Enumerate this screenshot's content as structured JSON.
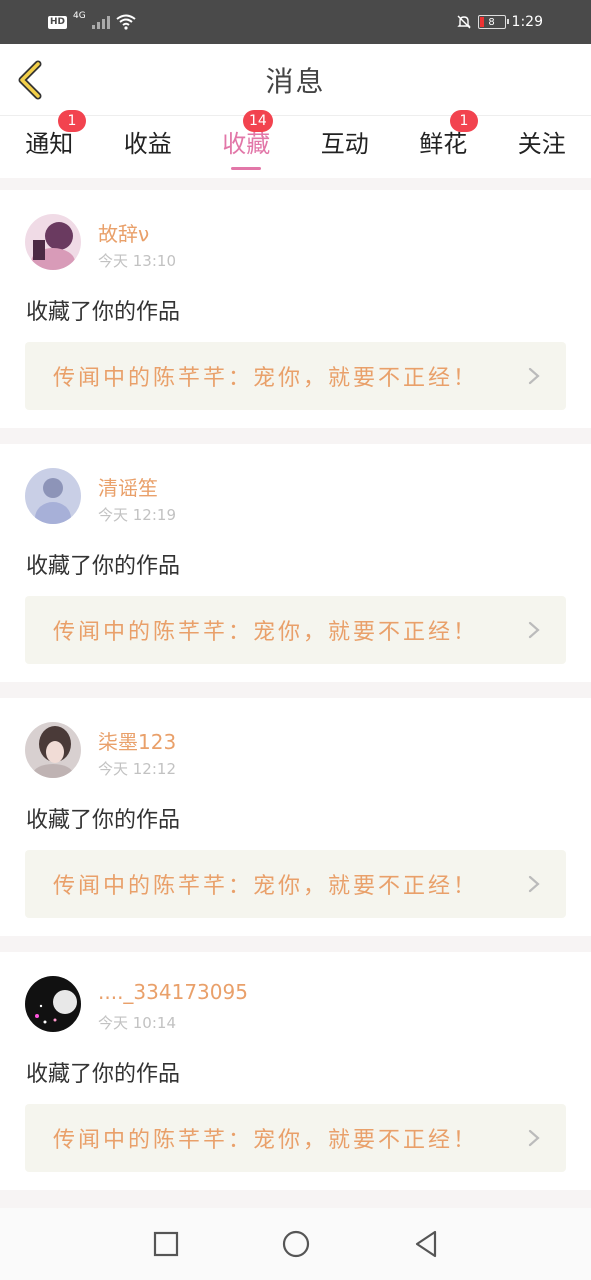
{
  "status_bar": {
    "hd": "HD",
    "network": "4G",
    "battery": "8",
    "time": "1:29"
  },
  "header": {
    "title": "消息",
    "back_icon": "chevron-left-icon"
  },
  "tabs": [
    {
      "label": "通知",
      "badge": "1",
      "active": false
    },
    {
      "label": "收益",
      "badge": "",
      "active": false
    },
    {
      "label": "收藏",
      "badge": "14",
      "active": true
    },
    {
      "label": "互动",
      "badge": "",
      "active": false
    },
    {
      "label": "鲜花",
      "badge": "1",
      "active": false
    },
    {
      "label": "关注",
      "badge": "",
      "active": false
    }
  ],
  "cards": [
    {
      "name": "故辞ν",
      "time": "今天 13:10",
      "action": "收藏了你的作品",
      "work": "传闻中的陈芊芊：宠你，就要不正经！"
    },
    {
      "name": "清谣笙",
      "time": "今天 12:19",
      "action": "收藏了你的作品",
      "work": "传闻中的陈芊芊：宠你，就要不正经！"
    },
    {
      "name": "柒墨123",
      "time": "今天 12:12",
      "action": "收藏了你的作品",
      "work": "传闻中的陈芊芊：宠你，就要不正经！"
    },
    {
      "name": "...._334173095",
      "time": "今天 10:14",
      "action": "收藏了你的作品",
      "work": "传闻中的陈芊芊：宠你，就要不正经！"
    }
  ],
  "colors": {
    "accent": "#e277a8",
    "badge": "#f2434f",
    "name": "#e9a06a"
  },
  "navbar": {
    "icons": [
      "square-icon",
      "circle-icon",
      "triangle-back-icon"
    ]
  }
}
